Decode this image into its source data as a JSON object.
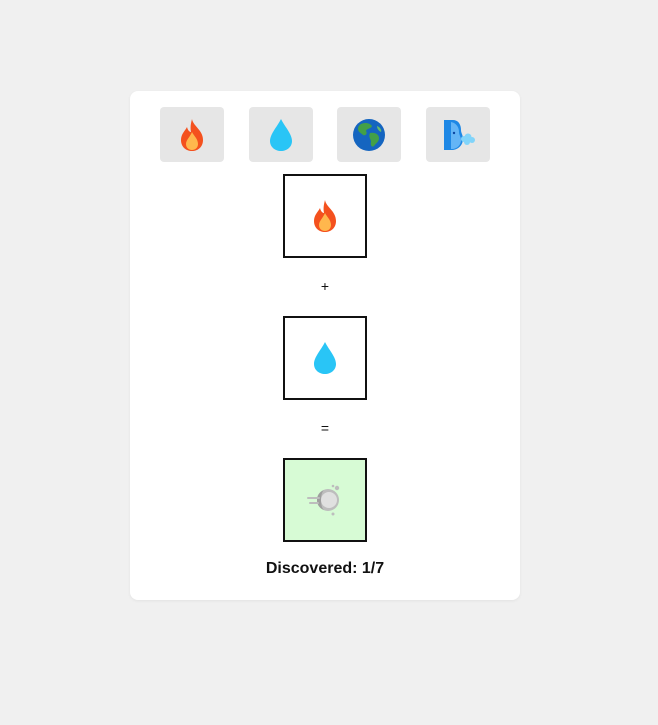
{
  "palette": [
    {
      "name": "fire",
      "icon": "fire-icon"
    },
    {
      "name": "water",
      "icon": "water-drop-icon"
    },
    {
      "name": "earth",
      "icon": "globe-icon"
    },
    {
      "name": "air",
      "icon": "wind-face-icon"
    }
  ],
  "combination": {
    "first": {
      "icon": "fire-icon"
    },
    "plus_sign": "+",
    "second": {
      "icon": "water-drop-icon"
    },
    "equals_sign": "=",
    "result": {
      "icon": "steam-icon"
    }
  },
  "status": {
    "discovered_text": "Discovered: 1/7"
  },
  "colors": {
    "result_background": "#d7fbd5",
    "palette_button_background": "#e6e6e6",
    "page_background": "#f0f0f0"
  }
}
